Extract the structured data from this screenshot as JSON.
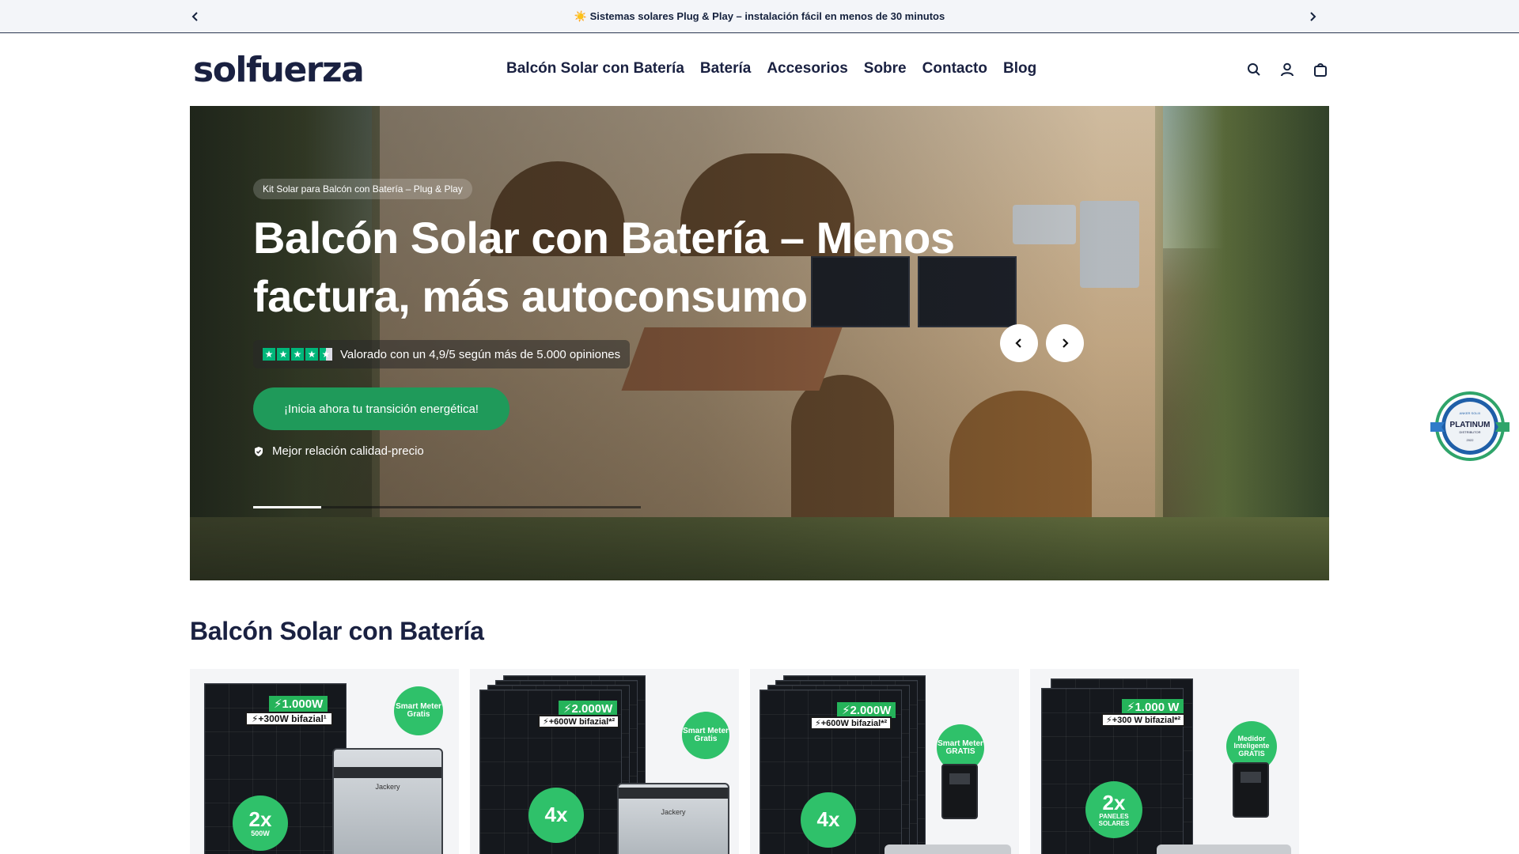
{
  "announcement": {
    "text": "☀️ Sistemas solares Plug & Play – instalación fácil en menos de 30 minutos",
    "prev_icon": "chevron-left-icon",
    "next_icon": "chevron-right-icon"
  },
  "header": {
    "logo": "solfuerza",
    "nav": [
      {
        "label": "Balcón Solar con Batería"
      },
      {
        "label": "Batería"
      },
      {
        "label": "Accesorios"
      },
      {
        "label": "Sobre"
      },
      {
        "label": "Contacto"
      },
      {
        "label": "Blog"
      }
    ],
    "icons": [
      "search-icon",
      "account-icon",
      "cart-icon"
    ]
  },
  "hero": {
    "badge": "Kit Solar para Balcón con Batería – Plug & Play",
    "title": "Balcón Solar con Batería – Menos factura, más autoconsumo",
    "rating_text": "Valorado con un 4,9/5 según más de 5.000 opiniones",
    "rating_stars": 4.5,
    "cta": "¡Inicia ahora tu transición energética!",
    "feature": "Mejor relación calidad-precio",
    "slide_progress": 0.175,
    "star_color": "#00b67a",
    "cta_color": "#1f9a5a"
  },
  "platinum": {
    "label": "PLATINUM",
    "small_top": "ANKER SOLIX",
    "small_bottom": "DISTRIBUTOR",
    "year": "2022"
  },
  "section": {
    "title": "Balcón Solar con Batería"
  },
  "products": [
    {
      "tag_main": "⚡1.000W",
      "tag_sub": "⚡+300W bifazial¹",
      "circle": "Smart Meter\nGratis",
      "count": "2x",
      "count_sub": "500W",
      "battery": "Jackery"
    },
    {
      "tag_main": "⚡2.000W",
      "tag_sub": "⚡+600W bifazial*²",
      "circle": "Smart Meter\nGratis",
      "count": "4x",
      "count_sub": "",
      "battery": "Jackery"
    },
    {
      "tag_main": "⚡2.000W",
      "tag_sub": "⚡+600W bifazial*²",
      "circle": "Smart Meter\nGRATIS",
      "count": "4x",
      "count_sub": ""
    },
    {
      "tag_main": "⚡1.000 W",
      "tag_sub": "⚡+300 W bifazial*²",
      "circle": "Medidor\nInteligente\nGRATIS",
      "count": "2x",
      "count_sub": "PANELES\nSOLARES"
    }
  ]
}
